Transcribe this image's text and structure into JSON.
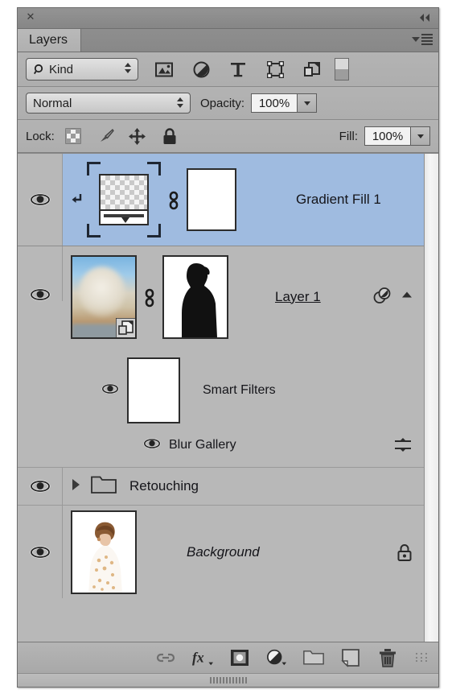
{
  "panel": {
    "title_tab": "Layers",
    "close_icon": "close-icon",
    "collapse_icon": "collapse-double-chevron-icon",
    "menu_icon": "panel-menu-icon"
  },
  "filter_row": {
    "kind_label": "Kind",
    "search_icon": "magnifier-icon",
    "filter_icons": [
      {
        "name": "pixel-layers-filter-icon",
        "title": "Pixel layers"
      },
      {
        "name": "adjustment-layers-filter-icon",
        "title": "Adjustment layers"
      },
      {
        "name": "type-layers-filter-icon",
        "title": "Type layers"
      },
      {
        "name": "shape-layers-filter-icon",
        "title": "Shape layers"
      },
      {
        "name": "smart-object-filter-icon",
        "title": "Smart objects"
      }
    ],
    "filter_toggle": "filter-enable-toggle"
  },
  "blend_row": {
    "blend_mode": "Normal",
    "opacity_label": "Opacity:",
    "opacity_value": "100%"
  },
  "lock_row": {
    "lock_label": "Lock:",
    "lock_icons": [
      {
        "name": "lock-transparency-icon"
      },
      {
        "name": "lock-image-pixels-icon"
      },
      {
        "name": "lock-position-icon"
      },
      {
        "name": "lock-all-icon"
      }
    ],
    "fill_label": "Fill:",
    "fill_value": "100%"
  },
  "layers": [
    {
      "id": "gradient-fill-1",
      "name": "Gradient Fill 1",
      "visible": true,
      "selected": true,
      "clipped": true,
      "linked": true,
      "has_mask": true,
      "style": "normal",
      "thumb_type": "gradient-checkerboard"
    },
    {
      "id": "layer-1",
      "name": "Layer 1",
      "visible": true,
      "selected": false,
      "clipped": false,
      "linked": true,
      "has_mask": true,
      "style": "underline",
      "thumb_type": "photo-blurred-landscape",
      "is_smart_object": true,
      "right_icon": "smart-filter-effects-icon",
      "smart_filters": {
        "label": "Smart Filters",
        "visible": true,
        "filters": [
          {
            "name": "Blur Gallery",
            "visible": true,
            "options_icon": "filter-blending-options-icon"
          }
        ]
      }
    },
    {
      "id": "retouching-group",
      "name": "Retouching",
      "visible": true,
      "selected": false,
      "style": "normal",
      "thumb_type": "group-folder",
      "expanded": false,
      "disclosure_icon": "chevron-right-icon",
      "folder_icon": "folder-icon"
    },
    {
      "id": "background",
      "name": "Background",
      "visible": true,
      "selected": false,
      "style": "italic",
      "thumb_type": "photo-portrait",
      "locked": true,
      "lock_icon": "padlock-icon"
    }
  ],
  "bottom_bar": {
    "buttons": [
      {
        "name": "link-layers-button",
        "icon": "link-icon"
      },
      {
        "name": "add-layer-style-button",
        "icon": "fx-icon"
      },
      {
        "name": "add-layer-mask-button",
        "icon": "layer-mask-icon"
      },
      {
        "name": "new-adjustment-layer-button",
        "icon": "half-filled-circle-icon"
      },
      {
        "name": "new-group-button",
        "icon": "folder-icon"
      },
      {
        "name": "new-layer-button",
        "icon": "new-layer-icon"
      },
      {
        "name": "delete-layer-button",
        "icon": "trash-icon"
      }
    ],
    "resize_grip": "resize-grip-icon"
  },
  "colors": {
    "panel_bg": "#a9a9a9",
    "list_bg": "#b8b8b8",
    "selected_row": "#9fbbe0",
    "chrome_dark": "#8a8a8a",
    "text": "#15151a"
  }
}
